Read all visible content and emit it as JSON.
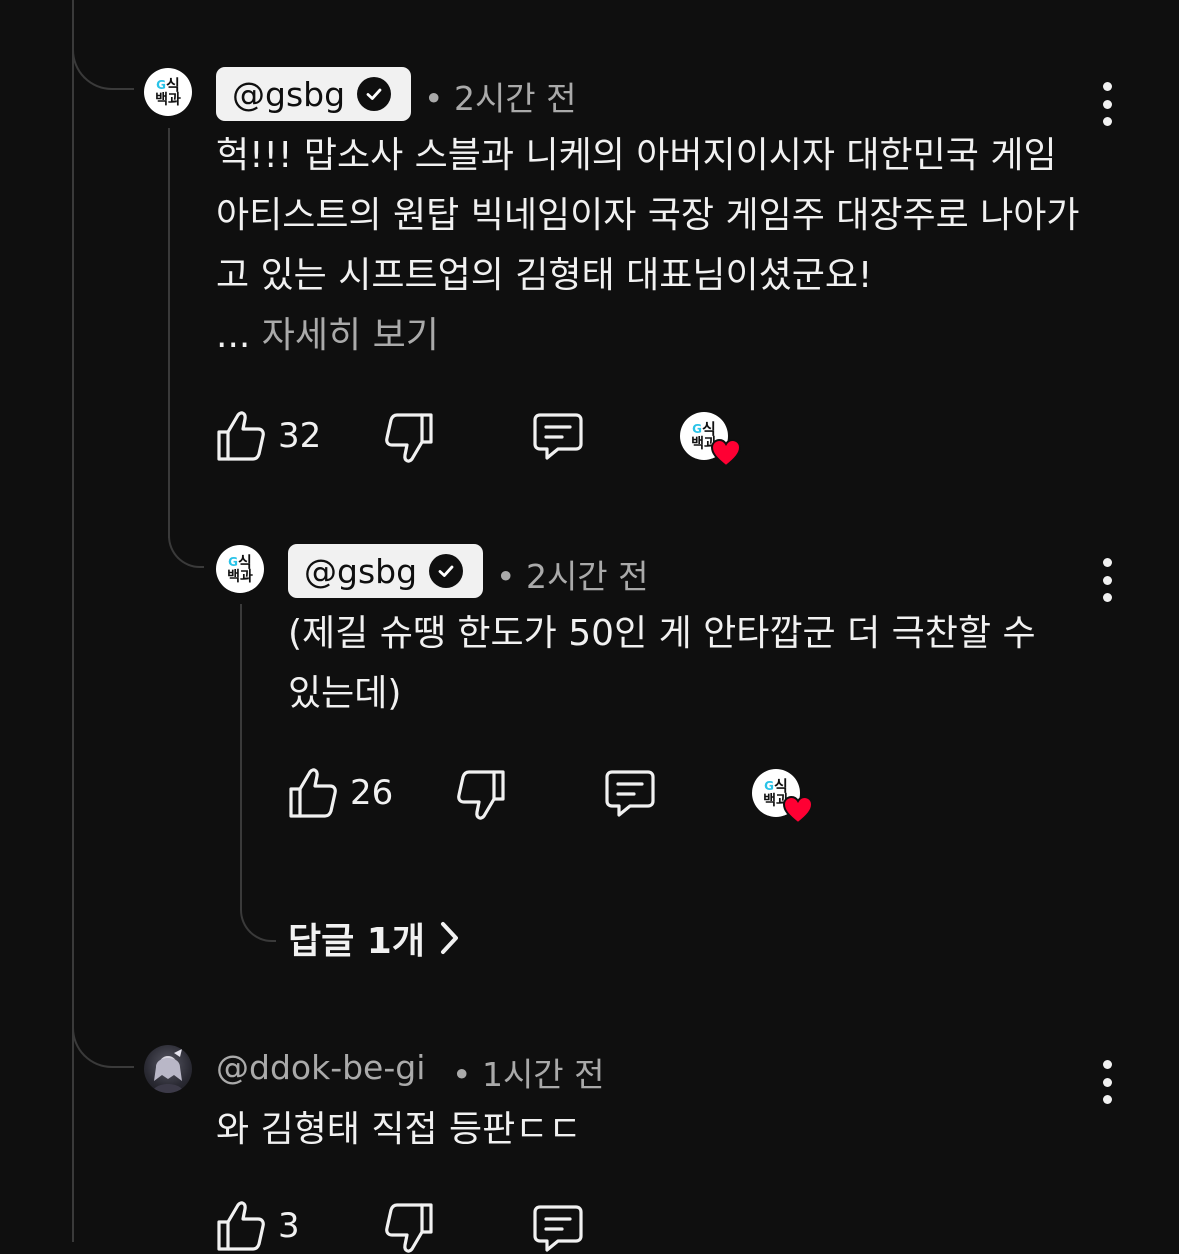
{
  "comments": [
    {
      "author": "@gsbg",
      "verified": true,
      "timestamp": "• 2시간 전",
      "text": "헉!!! 맙소사 스블과 니케의 아버지이시자 대한민국 게임 아티스트의 원탑 빅네임이자 국장 게임주 대장주로 나아가고 있는 시프트업의 김형태 대표님이셨군요!",
      "more_prefix": "... ",
      "more_label": "자세히 보기",
      "likes": "32",
      "avatar_logo": {
        "top": "식",
        "bottom": "백과",
        "g": "G"
      }
    },
    {
      "author": "@gsbg",
      "verified": true,
      "timestamp": "• 2시간 전",
      "text": "(제길 슈땡 한도가 50인 게 안타깝군 더 극찬할 수 있는데)",
      "likes": "26",
      "replies_label": "답글 1개",
      "avatar_logo": {
        "top": "식",
        "bottom": "백과",
        "g": "G"
      }
    },
    {
      "author": "@ddok-be-gi",
      "verified": false,
      "timestamp": "• 1시간 전",
      "text": "와 김형태 직접 등판ㄷㄷ",
      "likes": "3"
    }
  ],
  "icons": {
    "like": "thumb-up-icon",
    "dislike": "thumb-down-icon",
    "reply": "comment-icon",
    "creator_heart": "heart-icon",
    "more": "more-vertical-icon",
    "verified": "checkmark-icon",
    "chevron": "chevron-right-icon"
  },
  "colors": {
    "background": "#0f0f0f",
    "text": "#f1f1f1",
    "muted": "#aaaaaa",
    "heart": "#ff0033",
    "logo_accent": "#29c3e8"
  }
}
